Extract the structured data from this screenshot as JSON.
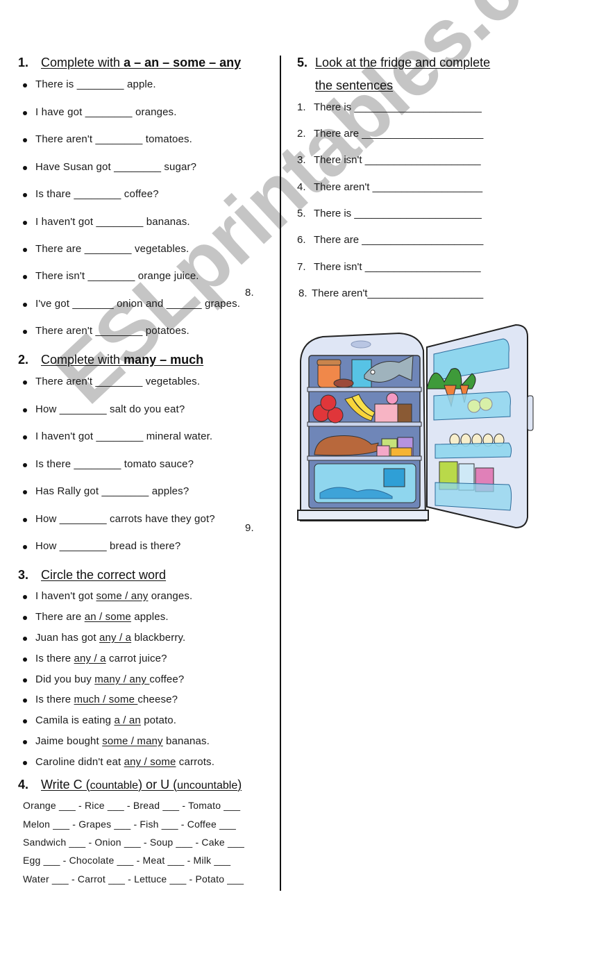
{
  "section1": {
    "number": "1.",
    "title_plain": "Complete with ",
    "title_bold": "a – an – some – any",
    "items": [
      "There is ________ apple.",
      "I have got ________ oranges.",
      "There aren't ________ tomatoes.",
      "Have Susan got ________ sugar?",
      "Is thare ________ coffee?",
      "I haven't got ________ bananas.",
      "There are ________ vegetables.",
      "There isn't ________ orange juice.",
      "I've got _______ onion and ______ grapes.",
      "There aren't ________ potatoes."
    ],
    "stray_marker": "8."
  },
  "section2": {
    "number": "2.",
    "title_plain": "Complete with ",
    "title_bold": "many – much",
    "items": [
      "There aren't ________ vegetables.",
      "How ________ salt do you eat?",
      "I haven't got ________ mineral water.",
      "Is there ________ tomato sauce?",
      "Has Rally got ________ apples?",
      "How ________  carrots have they got?",
      "How ________ bread is there?"
    ],
    "stray_marker": "9."
  },
  "section3": {
    "number": "3.",
    "title": "Circle the correct word",
    "items": [
      {
        "before": "I haven't got ",
        "choice": "some / any",
        "after": " oranges."
      },
      {
        "before": "There are ",
        "choice": "an / some",
        "after": " apples."
      },
      {
        "before": "Juan has got ",
        "choice": "any / a",
        "after": " blackberry."
      },
      {
        "before": "Is there ",
        "choice": "any / a",
        "after": " carrot juice?"
      },
      {
        "before": "Did you buy ",
        "choice": "many / any ",
        "after": "coffee?"
      },
      {
        "before": "Is there ",
        "choice": "much / some ",
        "after": "cheese?"
      },
      {
        "before": "Camila is eating ",
        "choice": "a / an",
        "after": " potato."
      },
      {
        "before": "Jaime bought ",
        "choice": "some / many",
        "after": " bananas."
      },
      {
        "before": "Caroline didn't eat ",
        "choice": "any / some",
        "after": " carrots."
      }
    ]
  },
  "section4": {
    "number": "4.",
    "title_a": "Write C (",
    "title_b": "countable",
    "title_c": ") or U (",
    "title_d": "uncountable",
    "title_e": ")",
    "rows": [
      "Orange ___ - Rice ___ - Bread ___ - Tomato ___",
      "Melon ___ - Grapes ___ - Fish ___ - Coffee ___",
      "Sandwich ___ - Onion ___ - Soup ___ - Cake ___",
      "Egg ___ - Chocolate ___ - Meat ___ - Milk ___",
      "Water ___ - Carrot ___ - Lettuce ___ - Potato ___"
    ]
  },
  "section5": {
    "number": "5.",
    "title_line1": "Look at the fridge and complete",
    "title_line2": "the sentences",
    "items": [
      {
        "n": "1.",
        "text": "There is ______________________"
      },
      {
        "n": "2.",
        "text": "There are _____________________"
      },
      {
        "n": "3.",
        "text": "There isn't ____________________"
      },
      {
        "n": "4.",
        "text": "There aren't ___________________"
      },
      {
        "n": "5.",
        "text": "There is ______________________"
      },
      {
        "n": "6.",
        "text": "There are _____________________"
      },
      {
        "n": "7.",
        "text": "There isn't ____________________"
      },
      {
        "n": "8.",
        "text": "There aren't____________________"
      }
    ],
    "image_alt": "Open fridge full of food"
  },
  "watermark": "ESLprintables.com",
  "colors": {
    "watermark": "#969696",
    "fridge_body": "#dfe6f5",
    "fridge_interior": "#6f86b8",
    "fridge_shelf": "#c9d3ec",
    "door_bins": "#8fd6ee"
  }
}
